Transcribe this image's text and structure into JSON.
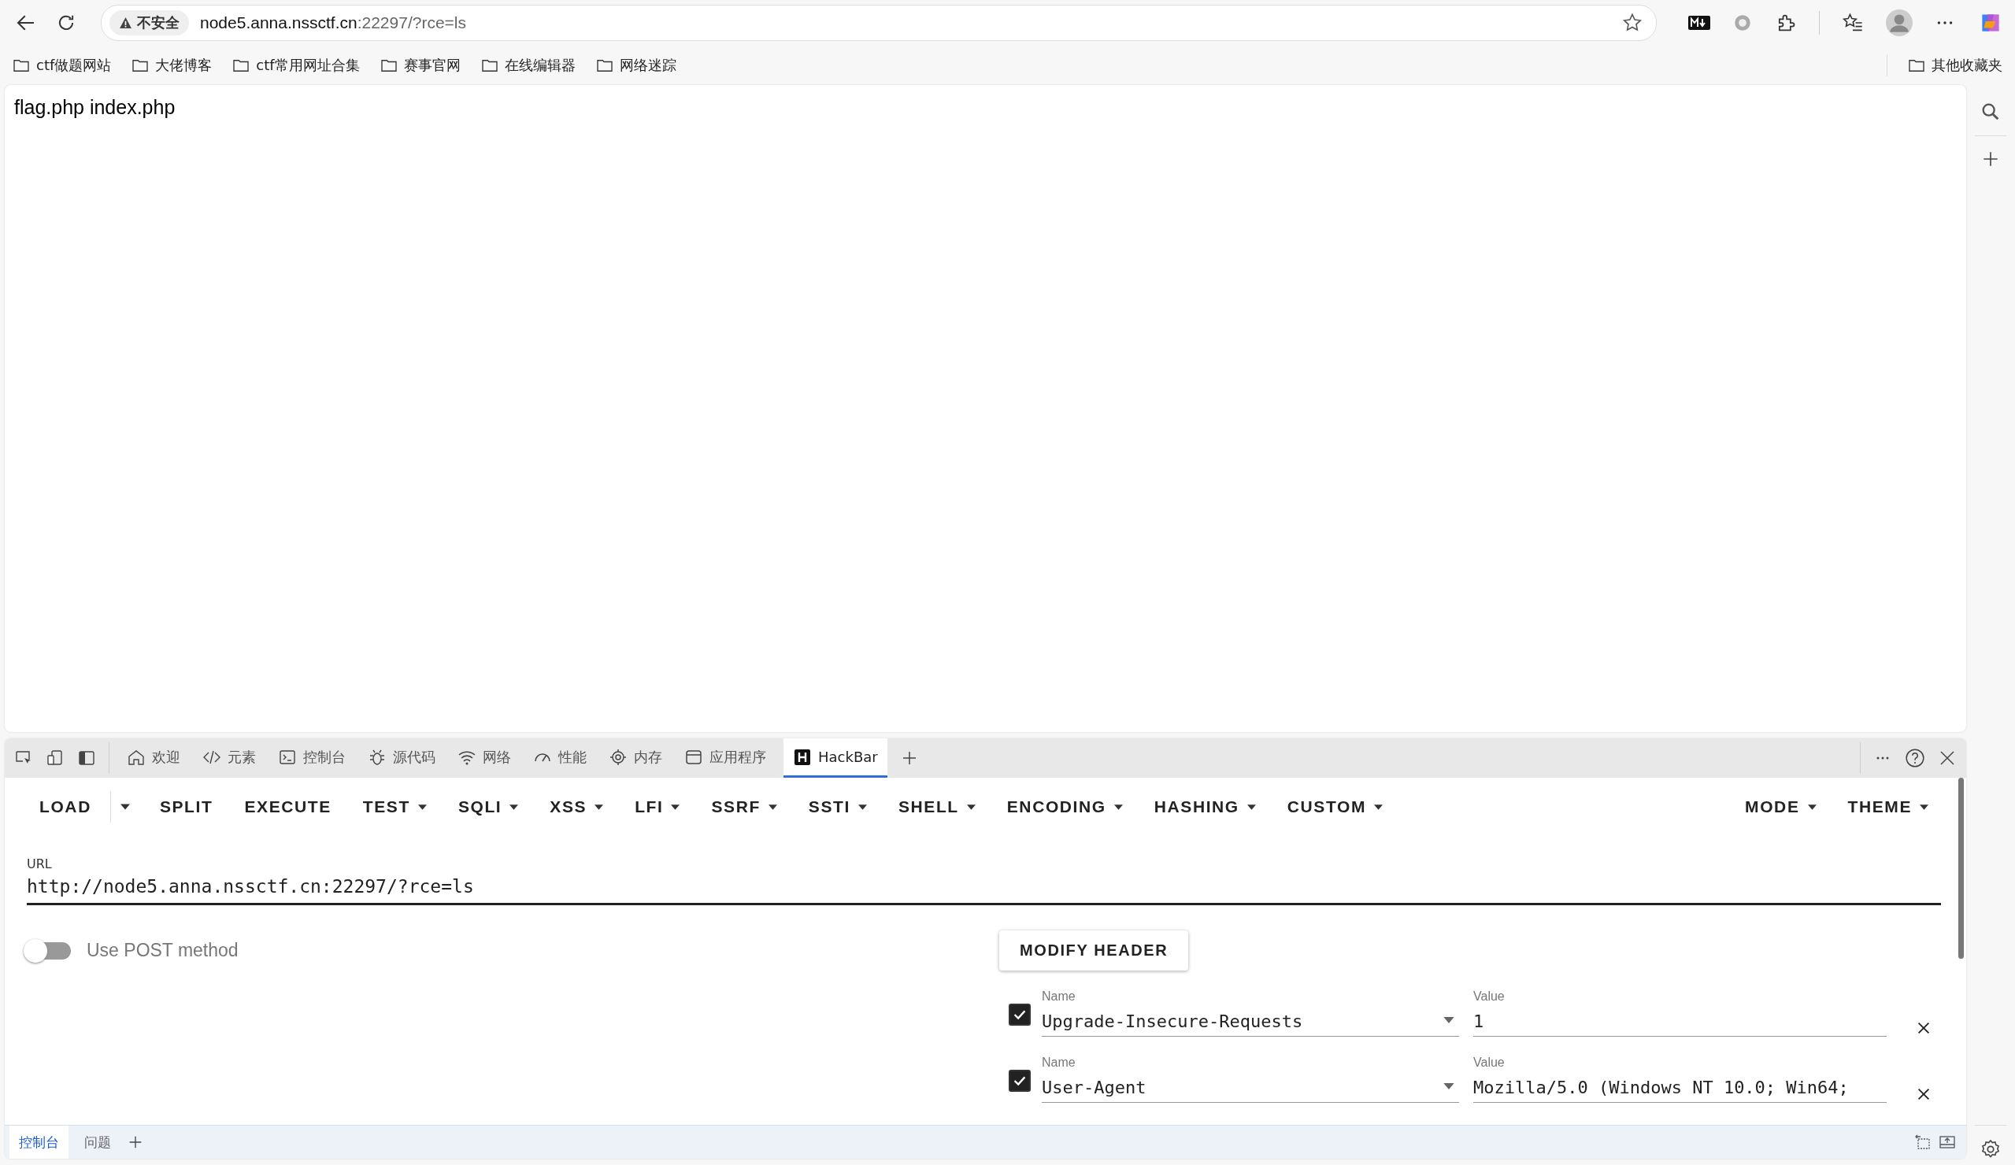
{
  "browser": {
    "address": {
      "security_label": "不安全",
      "host": "node5.anna.nssctf.cn",
      "rest": ":22297/?rce=ls"
    },
    "bookmarks": [
      "ctf做题网站",
      "大佬博客",
      "ctf常用网址合集",
      "赛事官网",
      "在线编辑器",
      "网络迷踪"
    ],
    "other_bookmarks": "其他收藏夹"
  },
  "page": {
    "text": "flag.php index.php"
  },
  "devtools": {
    "tabs": [
      {
        "label": "欢迎",
        "selected": false
      },
      {
        "label": "元素",
        "selected": false
      },
      {
        "label": "控制台",
        "selected": false
      },
      {
        "label": "源代码",
        "selected": false
      },
      {
        "label": "网络",
        "selected": false
      },
      {
        "label": "性能",
        "selected": false
      },
      {
        "label": "内存",
        "selected": false
      },
      {
        "label": "应用程序",
        "selected": false
      },
      {
        "label": "HackBar",
        "selected": true
      }
    ],
    "hackbar": {
      "menu": [
        {
          "label": "LOAD",
          "kind": "split"
        },
        {
          "label": "SPLIT",
          "kind": "button"
        },
        {
          "label": "EXECUTE",
          "kind": "button"
        },
        {
          "label": "TEST",
          "kind": "menu"
        },
        {
          "label": "SQLI",
          "kind": "menu"
        },
        {
          "label": "XSS",
          "kind": "menu"
        },
        {
          "label": "LFI",
          "kind": "menu"
        },
        {
          "label": "SSRF",
          "kind": "menu"
        },
        {
          "label": "SSTI",
          "kind": "menu"
        },
        {
          "label": "SHELL",
          "kind": "menu"
        },
        {
          "label": "ENCODING",
          "kind": "menu"
        },
        {
          "label": "HASHING",
          "kind": "menu"
        },
        {
          "label": "CUSTOM",
          "kind": "menu"
        }
      ],
      "right_menu": [
        {
          "label": "MODE",
          "kind": "menu"
        },
        {
          "label": "THEME",
          "kind": "menu"
        }
      ],
      "url": {
        "label": "URL",
        "value": "http://node5.anna.nssctf.cn:22297/?rce=ls"
      },
      "post_toggle": {
        "label": "Use POST method",
        "on": false
      },
      "modify_header": "MODIFY HEADER",
      "headers": [
        {
          "enabled": true,
          "name_label": "Name",
          "name": "Upgrade-Insecure-Requests",
          "value_label": "Value",
          "value": "1"
        },
        {
          "enabled": true,
          "name_label": "Name",
          "name": "User-Agent",
          "value_label": "Value",
          "value": "Mozilla/5.0 (Windows NT 10.0; Win64;"
        }
      ]
    },
    "drawer_tabs": [
      {
        "label": "控制台",
        "selected": true
      },
      {
        "label": "问题",
        "selected": false
      }
    ]
  }
}
